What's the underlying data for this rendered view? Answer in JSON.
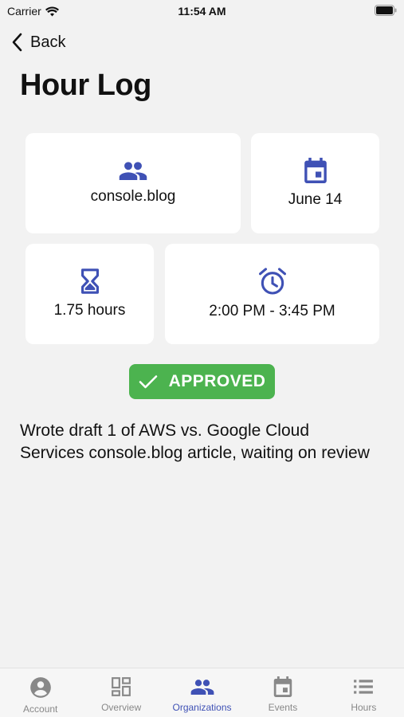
{
  "status_bar": {
    "carrier": "Carrier",
    "time": "11:54 AM"
  },
  "nav": {
    "back_label": "Back"
  },
  "page": {
    "title": "Hour Log"
  },
  "details": {
    "organization": "console.blog",
    "date": "June 14",
    "hours": "1.75 hours",
    "time_range": "2:00 PM - 3:45 PM"
  },
  "status": {
    "label": "APPROVED",
    "color": "#4cb34f"
  },
  "description": "Wrote draft 1 of AWS vs. Google Cloud Services console.blog article, waiting on review",
  "tabs": [
    {
      "label": "Account",
      "icon": "account-circle-icon"
    },
    {
      "label": "Overview",
      "icon": "dashboard-icon"
    },
    {
      "label": "Organizations",
      "icon": "people-icon",
      "active": true
    },
    {
      "label": "Events",
      "icon": "calendar-icon"
    },
    {
      "label": "Hours",
      "icon": "list-icon"
    }
  ],
  "colors": {
    "accent": "#3f51b5",
    "background": "#f2f2f2"
  }
}
